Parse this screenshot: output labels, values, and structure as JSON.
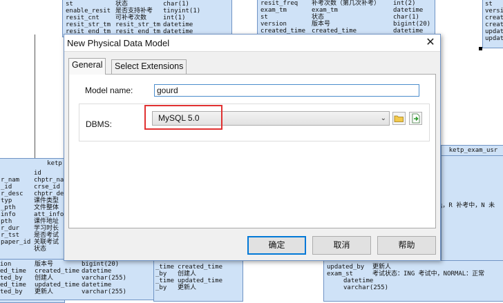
{
  "background": {
    "top_left_rows": [
      [
        "st",
        "状态",
        "char(1)"
      ],
      [
        "enable_resit",
        "是否支持补考",
        "tinyint(1)"
      ],
      [
        "resit_cnt",
        "可补考次数",
        "int(1)"
      ],
      [
        "resit_str_tm",
        "resit_str_tm",
        "datetime"
      ],
      [
        "resit_end_tm",
        "resit_end_tm",
        "datetime"
      ]
    ],
    "top_mid_rows": [
      [
        "resit_freq",
        "补考次数（第几次补考）",
        "int(2)"
      ],
      [
        "exam_tm",
        "exam_tm",
        "datetime"
      ],
      [
        "st",
        "状态",
        "char(1)"
      ],
      [
        "version",
        "版本号",
        "bigint(20)"
      ],
      [
        "created_time",
        "created_time",
        "datetime"
      ]
    ],
    "top_right_rows": [
      "st",
      "versio",
      "create",
      "create",
      "update",
      "update"
    ],
    "left_table_title": "ketp",
    "left_rows": [
      [
        "",
        "id",
        ""
      ],
      [
        "r_nam",
        "chptr_nam",
        ""
      ],
      [
        "_id",
        "crse_id",
        ""
      ],
      [
        "r_desc",
        "chptr_desc",
        ""
      ],
      [
        "typ",
        "课件类型",
        ""
      ],
      [
        "_pth",
        "文件整体",
        ""
      ],
      [
        "info",
        "att_info",
        ""
      ],
      [
        "pth",
        "课件地址",
        ""
      ],
      [
        "r_dur",
        "学习时长",
        ""
      ],
      [
        "r_tst",
        "是否考试",
        ""
      ],
      [
        "paper_id",
        "关联考试",
        ""
      ],
      [
        "",
        "状态",
        ""
      ],
      [
        "ion",
        "版本号",
        "bigint(20)"
      ],
      [
        "ed_time",
        "created_time",
        "datetime"
      ],
      [
        "ted_by",
        "创建人",
        "varchar(255)"
      ],
      [
        "ed_time",
        "updated_time",
        "datetime"
      ],
      [
        "ted_by",
        "更新人",
        "varchar(255)"
      ]
    ],
    "mid_bottom_rows": [
      [
        "_time",
        "created_time",
        ""
      ],
      [
        "_by",
        "创建人",
        ""
      ],
      [
        "_time",
        "updated_time",
        ""
      ],
      [
        "_by",
        "更新人",
        ""
      ]
    ],
    "right_table_title": "ketp_exam_usr",
    "right_partial_text": "ц，R 补考中，N 未",
    "bottom_right_rows": [
      [
        "updated_by",
        "更新人",
        ""
      ],
      [
        "exam_st",
        "考试状态：ING 考试中，NORMAL：正常",
        ""
      ],
      [
        "",
        "datetime",
        ""
      ],
      [
        "",
        "varchar(255)",
        ""
      ]
    ]
  },
  "dialog": {
    "title": "New Physical Data Model",
    "close_glyph": "✕",
    "tabs": [
      {
        "label": "General"
      },
      {
        "label": "Select Extensions"
      }
    ],
    "model_name_label": "Model name:",
    "model_name_value": "gourd",
    "dbms_label": "DBMS:",
    "dbms_value": "MySQL 5.0",
    "dbms_dropdown_glyph": "⌄",
    "highlight_color": "#e03030",
    "buttons": {
      "ok": "确定",
      "cancel": "取消",
      "help": "帮助"
    },
    "icons": {
      "open_folder": "folder-icon",
      "new_dbms": "new-file-icon"
    }
  }
}
